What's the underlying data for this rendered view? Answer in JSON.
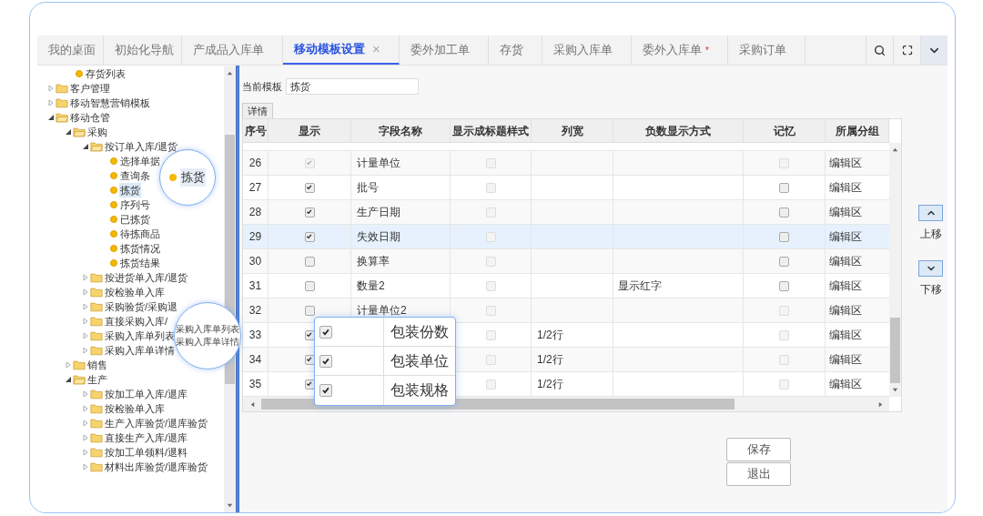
{
  "tabs": [
    {
      "label": "我的桌面",
      "selected": false,
      "closable": false,
      "modified": false
    },
    {
      "label": "初始化导航",
      "selected": false,
      "closable": false,
      "modified": false
    },
    {
      "label": "产成品入库单",
      "selected": false,
      "closable": false,
      "modified": false
    },
    {
      "label": "移动模板设置",
      "selected": true,
      "closable": true,
      "modified": false
    },
    {
      "label": "委外加工单",
      "selected": false,
      "closable": false,
      "modified": false
    },
    {
      "label": "存货",
      "selected": false,
      "closable": false,
      "modified": false
    },
    {
      "label": "采购入库单",
      "selected": false,
      "closable": false,
      "modified": false
    },
    {
      "label": "委外入库单",
      "selected": false,
      "closable": false,
      "modified": true
    },
    {
      "label": "采购订单",
      "selected": false,
      "closable": false,
      "modified": false
    }
  ],
  "tab_close": "×",
  "tab_modified_mark": "*",
  "tree": [
    {
      "kind": "group",
      "children": [
        {
          "kind": "group",
          "children": [
            {
              "kind": "leaf",
              "label": "存货列表",
              "selected": false
            }
          ]
        },
        {
          "kind": "folder",
          "label": "客户管理",
          "expanded": false,
          "selected": false
        }
      ]
    },
    {
      "kind": "folder",
      "label": "移动智慧营销模板",
      "expanded": false,
      "selected": false
    },
    {
      "kind": "folder",
      "label": "移动仓管",
      "expanded": true,
      "selected": false,
      "children": [
        {
          "kind": "folder",
          "label": "采购",
          "expanded": true,
          "selected": false,
          "children": [
            {
              "kind": "folder",
              "label": "按订单入库/退货",
              "expanded": true,
              "selected": false,
              "children": [
                {
                  "kind": "leaf",
                  "label": "选择单据",
                  "selected": false
                },
                {
                  "kind": "leaf",
                  "label": "查询条",
                  "selected": false
                },
                {
                  "kind": "leaf",
                  "label": "拣货",
                  "selected": true
                },
                {
                  "kind": "leaf",
                  "label": "序列号",
                  "selected": false
                },
                {
                  "kind": "leaf",
                  "label": "已拣货",
                  "selected": false
                },
                {
                  "kind": "leaf",
                  "label": "待拣商品",
                  "selected": false
                },
                {
                  "kind": "leaf",
                  "label": "拣货情况",
                  "selected": false
                },
                {
                  "kind": "leaf",
                  "label": "拣货结果",
                  "selected": false
                }
              ]
            },
            {
              "kind": "folder",
              "label": "按进货单入库/退货",
              "expanded": false,
              "selected": false
            },
            {
              "kind": "folder",
              "label": "按检验单入库",
              "expanded": false,
              "selected": false
            },
            {
              "kind": "folder",
              "label": "采购验货/采购退",
              "expanded": false,
              "selected": false
            },
            {
              "kind": "folder",
              "label": "直接采购入库/",
              "expanded": false,
              "selected": false
            },
            {
              "kind": "folder",
              "label": "采购入库单列表",
              "expanded": false,
              "selected": false
            },
            {
              "kind": "folder",
              "label": "采购入库单详情",
              "expanded": false,
              "selected": false
            }
          ]
        },
        {
          "kind": "folder",
          "label": "销售",
          "expanded": false,
          "selected": false
        },
        {
          "kind": "folder",
          "label": "生产",
          "expanded": true,
          "selected": false,
          "children": [
            {
              "kind": "folder",
              "label": "按加工单入库/退库",
              "expanded": false,
              "selected": false
            },
            {
              "kind": "folder",
              "label": "按检验单入库",
              "expanded": false,
              "selected": false
            },
            {
              "kind": "folder",
              "label": "生产入库验货/退库验货",
              "expanded": false,
              "selected": false
            },
            {
              "kind": "folder",
              "label": "直接生产入库/退库",
              "expanded": false,
              "selected": false
            },
            {
              "kind": "folder",
              "label": "按加工单领料/退料",
              "expanded": false,
              "selected": false
            },
            {
              "kind": "folder",
              "label": "材料出库验货/退库验货",
              "expanded": false,
              "selected": false
            }
          ]
        }
      ]
    }
  ],
  "tree_callouts": [
    {
      "kind": "single",
      "texts": [
        "拣货"
      ]
    },
    {
      "kind": "double",
      "texts": [
        "采购入库单列表",
        "采购入库单详情"
      ]
    }
  ],
  "template": {
    "label": "当前模板",
    "value": "拣货"
  },
  "detail_tabs": [
    {
      "label": "详情",
      "selected": true
    }
  ],
  "table": {
    "columns": [
      "序号",
      "显示",
      "字段名称",
      "显示成标题样式",
      "列宽",
      "负数显示方式",
      "记忆",
      "所属分组"
    ],
    "rows": [
      {
        "no": "26",
        "show": {
          "checked": true,
          "disabled": true
        },
        "field": "计量单位",
        "title_style": {
          "checked": false,
          "disabled": true
        },
        "memory": {
          "checked": false,
          "disabled": true
        },
        "group": "编辑区",
        "selected": false
      },
      {
        "no": "27",
        "show": {
          "checked": true,
          "disabled": false
        },
        "field": "批号",
        "title_style": {
          "checked": false,
          "disabled": true
        },
        "memory": {
          "checked": false,
          "disabled": false
        },
        "group": "编辑区",
        "selected": false
      },
      {
        "no": "28",
        "show": {
          "checked": true,
          "disabled": false
        },
        "field": "生产日期",
        "title_style": {
          "checked": false,
          "disabled": true
        },
        "memory": {
          "checked": false,
          "disabled": false
        },
        "group": "编辑区",
        "selected": false
      },
      {
        "no": "29",
        "show": {
          "checked": true,
          "disabled": false
        },
        "field": "失效日期",
        "title_style": {
          "checked": false,
          "disabled": true
        },
        "memory": {
          "checked": false,
          "disabled": false
        },
        "group": "编辑区",
        "selected": true
      },
      {
        "no": "30",
        "show": {
          "checked": false,
          "disabled": false
        },
        "field": "换算率",
        "title_style": {
          "checked": false,
          "disabled": true
        },
        "memory": {
          "checked": false,
          "disabled": false
        },
        "group": "编辑区",
        "selected": false
      },
      {
        "no": "31",
        "show": {
          "checked": false,
          "disabled": false
        },
        "field": "数量2",
        "title_style": {
          "checked": false,
          "disabled": true
        },
        "negative": "显示红字",
        "memory": {
          "checked": false,
          "disabled": false
        },
        "group": "编辑区",
        "selected": false
      },
      {
        "no": "32",
        "show": {
          "checked": false,
          "disabled": false
        },
        "field": "计量单位2",
        "title_style": {
          "checked": false,
          "disabled": true
        },
        "memory": {
          "checked": false,
          "disabled": true
        },
        "group": "编辑区",
        "selected": false
      },
      {
        "no": "33",
        "show": {
          "checked": true,
          "disabled": false
        },
        "title_style": {
          "checked": false,
          "disabled": true
        },
        "width": "1/2行",
        "memory": {
          "checked": false,
          "disabled": true
        },
        "group": "编辑区",
        "selected": false
      },
      {
        "no": "34",
        "show": {
          "checked": true,
          "disabled": false
        },
        "title_style": {
          "checked": false,
          "disabled": true
        },
        "width": "1/2行",
        "memory": {
          "checked": false,
          "disabled": true
        },
        "group": "编辑区",
        "selected": false
      },
      {
        "no": "35",
        "show": {
          "checked": true,
          "disabled": false
        },
        "title_style": {
          "checked": false,
          "disabled": true
        },
        "width": "1/2行",
        "memory": {
          "checked": false,
          "disabled": true
        },
        "group": "编辑区",
        "selected": false
      }
    ]
  },
  "zoom_popup": [
    {
      "checked": true,
      "field": "包装份数"
    },
    {
      "checked": true,
      "field": "包装单位"
    },
    {
      "checked": true,
      "field": "包装规格"
    }
  ],
  "move_buttons": [
    "上移",
    "下移"
  ],
  "buttons": [
    "保存",
    "退出"
  ]
}
